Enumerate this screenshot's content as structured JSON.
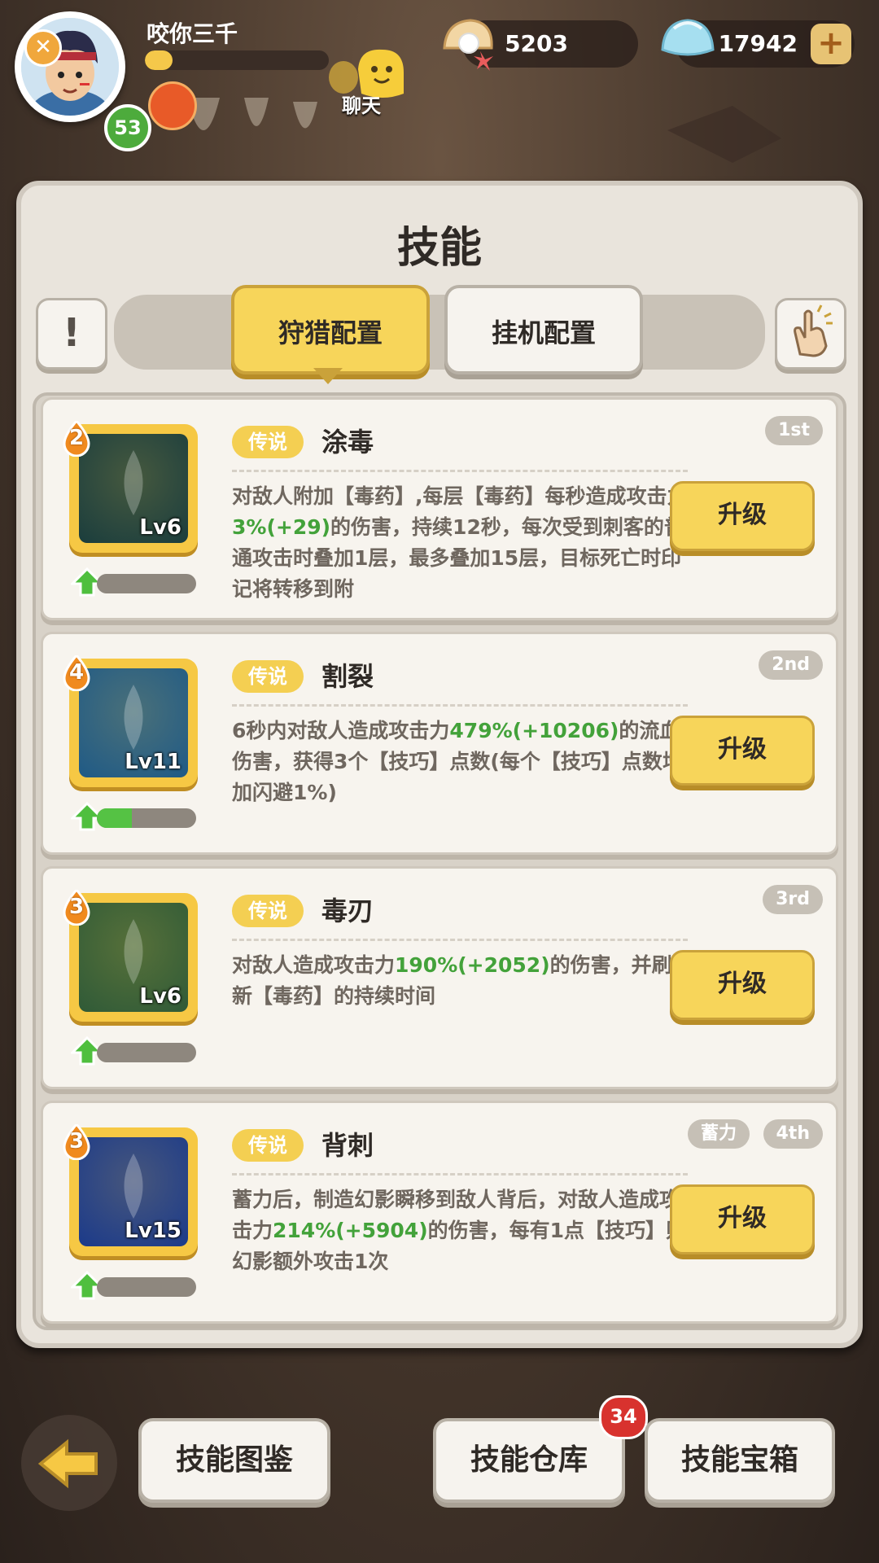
{
  "player": {
    "name": "咬你三千",
    "level": "53",
    "exp_progress": 0.15
  },
  "chat": {
    "label": "聊天"
  },
  "resources": {
    "pearls": "5203",
    "gems": "17942",
    "add_label": "+"
  },
  "panel": {
    "title": "技能",
    "info_label": "!",
    "tabs": [
      {
        "label": "狩猎配置",
        "active": true
      },
      {
        "label": "挂机配置",
        "active": false
      }
    ]
  },
  "skills": [
    {
      "quality": "传说",
      "name": "涂毒",
      "level": "Lv6",
      "stars": "2",
      "rank": "1st",
      "tag": "",
      "desc_parts": [
        "对敌人附加【毒药】,每层【毒药】每秒造成攻击力",
        "3%",
        "(+29)",
        "的伤害，持续12秒，每次受到刺客的普通攻击时叠加1层，最多叠加15层，目标死亡时印记将转移到附"
      ],
      "progress": 0.0,
      "upgrade_label": "升级",
      "color": "#1a3d3d"
    },
    {
      "quality": "传说",
      "name": "割裂",
      "level": "Lv11",
      "stars": "4",
      "rank": "2nd",
      "tag": "",
      "desc_parts": [
        "6秒内对敌人造成攻击力",
        "479%",
        "(+10206)",
        "的流血伤害，获得3个【技巧】点数(每个【技巧】点数增加闪避1%)"
      ],
      "progress": 0.35,
      "upgrade_label": "升级",
      "color": "#1f5a86"
    },
    {
      "quality": "传说",
      "name": "毒刃",
      "level": "Lv6",
      "stars": "3",
      "rank": "3rd",
      "tag": "",
      "desc_parts": [
        "对敌人造成攻击力",
        "190%",
        "(+2052)",
        "的伤害，并刷新【毒药】的持续时间"
      ],
      "progress": 0.0,
      "upgrade_label": "升级",
      "color": "#2f5a37"
    },
    {
      "quality": "传说",
      "name": "背刺",
      "level": "Lv15",
      "stars": "3",
      "rank": "4th",
      "tag": "蓄力",
      "desc_parts": [
        "蓄力后，制造幻影瞬移到敌人背后，对敌人造成攻击力",
        "214%",
        "(+5904)",
        "的伤害，每有1点【技巧】则幻影额外攻击1次"
      ],
      "progress": 0.0,
      "upgrade_label": "升级",
      "color": "#1b3a8a"
    }
  ],
  "bottom": {
    "codex_label": "技能图鉴",
    "storage_label": "技能仓库",
    "storage_badge": "34",
    "chest_label": "技能宝箱"
  },
  "colors": {
    "accent_yellow": "#f7d55a",
    "highlight_green": "#43a23a",
    "panel_bg": "#e9e4dc"
  }
}
